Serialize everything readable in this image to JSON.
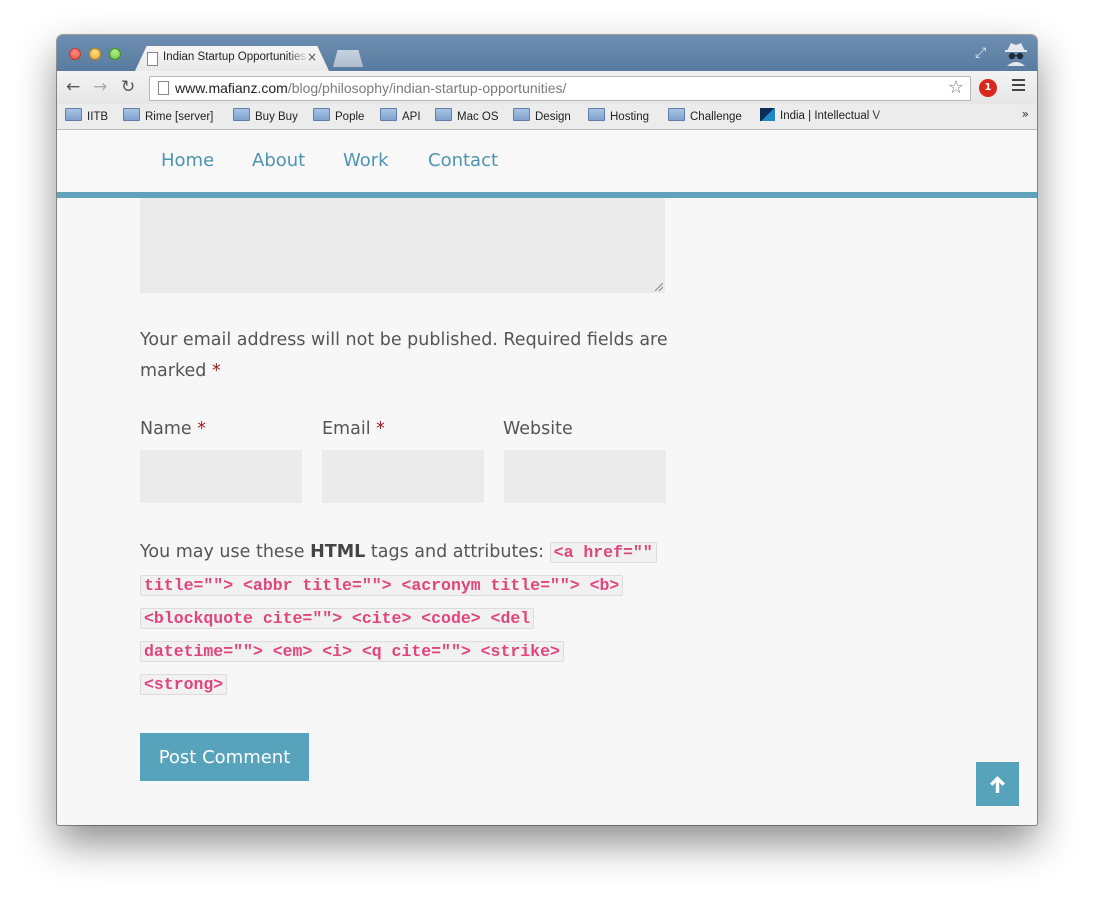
{
  "browser": {
    "tab_title": "Indian Startup Opportunities",
    "tab_close": "×",
    "url_host": "www.mafianz.com",
    "url_path": "/blog/philosophy/indian-startup-opportunities/",
    "extension_badge": "1",
    "bookmarks": [
      {
        "label": "IITB",
        "type": "folder"
      },
      {
        "label": "Rime [server]",
        "type": "folder"
      },
      {
        "label": "Buy Buy",
        "type": "folder"
      },
      {
        "label": "Pople",
        "type": "folder"
      },
      {
        "label": "API",
        "type": "folder"
      },
      {
        "label": "Mac OS",
        "type": "folder"
      },
      {
        "label": "Design",
        "type": "folder"
      },
      {
        "label": "Hosting",
        "type": "folder"
      },
      {
        "label": "Challenge",
        "type": "folder"
      },
      {
        "label": "India | Intellectual V",
        "type": "site"
      }
    ],
    "bookmarks_overflow": "»"
  },
  "nav": {
    "items": [
      {
        "label": "Home"
      },
      {
        "label": "About"
      },
      {
        "label": "Work"
      },
      {
        "label": "Contact"
      }
    ]
  },
  "form": {
    "notes_line1": "Your email address will not be published. Required fields are",
    "notes_line2": "marked",
    "required_mark": "*",
    "name_label": "Name",
    "email_label": "Email",
    "website_label": "Website",
    "allowed_prefix": "You may use these",
    "allowed_bold": "HTML",
    "allowed_suffix": "tags and attributes:",
    "allowed_tags": [
      "<a href=\"\"",
      "title=\"\"> <abbr title=\"\"> <acronym title=\"\"> <b>",
      "<blockquote cite=\"\"> <cite> <code> <del",
      "datetime=\"\"> <em> <i> <q cite=\"\"> <strike>",
      "<strong>"
    ],
    "submit_label": "Post Comment"
  },
  "colors": {
    "accent": "#57a3bb",
    "nav_link": "#4e94b0",
    "code_text": "#e0457b",
    "required": "#9b1c1c"
  },
  "icons": {
    "back": "left-arrow-icon",
    "forward": "right-arrow-icon",
    "reload": "reload-icon",
    "bookmark_star": "star-icon",
    "menu": "hamburger-menu-icon",
    "scroll_top": "arrow-up-icon"
  }
}
